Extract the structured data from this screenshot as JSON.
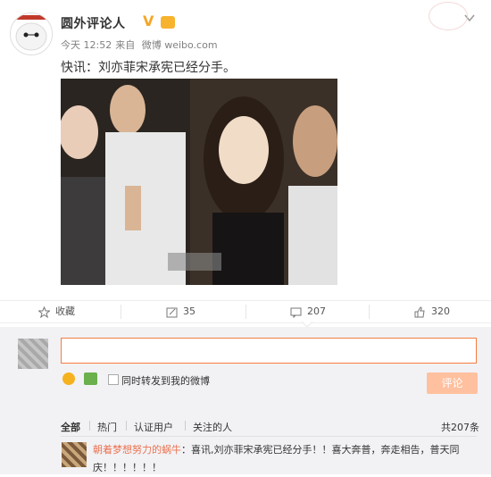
{
  "post": {
    "username": "圆外评论人",
    "verified_icon": "v-badge-icon",
    "member_icon": "crown-icon",
    "time": "今天 12:52",
    "source_prefix": "来自",
    "source": "微博 weibo.com",
    "content": "快讯：刘亦菲宋承宪已经分手。"
  },
  "actions": {
    "favorite_label": "收藏",
    "repost_count": "35",
    "comment_count": "207",
    "like_count": "320"
  },
  "comment_box": {
    "placeholder": "",
    "also_repost_label": "同时转发到我的微博",
    "submit_label": "评论"
  },
  "comment_tabs": {
    "items": [
      "全部",
      "热门",
      "认证用户",
      "关注的人"
    ],
    "active": "全部",
    "total": "共207条"
  },
  "comments": [
    {
      "user": "朝着梦想努力的蜗牛",
      "text": "：喜讯,刘亦菲宋承宪已经分手！！喜大奔普，奔走相告，普天同庆！！！！！！"
    }
  ],
  "colors": {
    "accent": "#eb7350",
    "input_border": "#f77c3d",
    "submit_bg": "#ffc09f"
  }
}
